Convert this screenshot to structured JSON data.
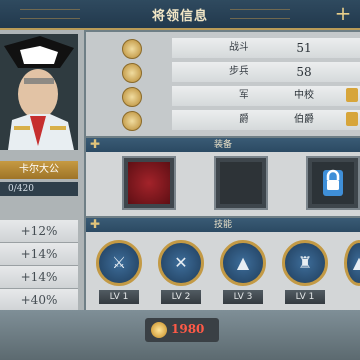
{
  "header": {
    "title": "将领信息",
    "plus": "+"
  },
  "general": {
    "name": "卡尔大公",
    "xp": "0/420"
  },
  "bonuses": [
    "+12%",
    "+14%",
    "+14%",
    "+40%"
  ],
  "stats": [
    {
      "label": "战斗能力",
      "value": "51"
    },
    {
      "label": "步兵能力",
      "value": "58"
    },
    {
      "label": "军衔",
      "value": "中校"
    },
    {
      "label": "爵位",
      "value": "伯爵"
    }
  ],
  "sections": {
    "equipment": "装备",
    "skills": "技能"
  },
  "skills": [
    {
      "level": "LV 1"
    },
    {
      "level": "LV 2"
    },
    {
      "level": "LV 3"
    },
    {
      "level": "LV 1"
    }
  ],
  "cost": {
    "value": "1980"
  },
  "colors": {
    "accent_gold": "#c39a45",
    "cost_red": "#ff5a47",
    "header_blue": "#2f4a5f"
  }
}
